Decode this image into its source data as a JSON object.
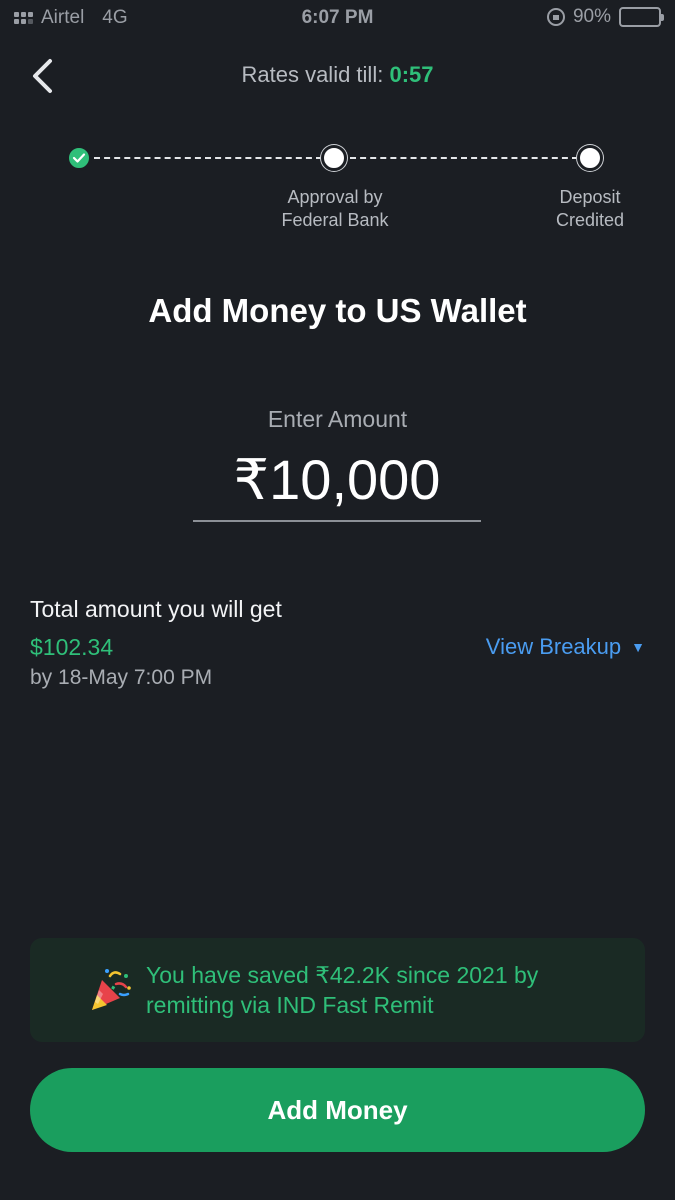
{
  "status_bar": {
    "carrier": "Airtel",
    "network": "4G",
    "time": "6:07 PM",
    "battery": "90%"
  },
  "header": {
    "rates_label": "Rates valid till:",
    "rates_timer": "0:57",
    "back_icon": "chevron-left-icon"
  },
  "stepper": {
    "steps": [
      {
        "label": "",
        "status": "done"
      },
      {
        "label_line1": "Approval by",
        "label_line2": "Federal Bank",
        "status": "pending"
      },
      {
        "label_line1": "Deposit",
        "label_line2": "Credited",
        "status": "pending"
      }
    ]
  },
  "main": {
    "title": "Add Money to US Wallet",
    "amount_label": "Enter Amount",
    "amount_value": "₹10,000",
    "total_label": "Total amount you will get",
    "total_value": "$102.34",
    "total_date": "by 18-May 7:00 PM",
    "view_breakup": "View Breakup"
  },
  "banner": {
    "icon": "party-popper-icon",
    "text": "You have saved ₹42.2K since 2021 by remitting via IND Fast Remit"
  },
  "cta": {
    "label": "Add Money"
  },
  "colors": {
    "background": "#1b1e23",
    "accent_green": "#2fbf79",
    "button_green": "#1a9e5e",
    "link_blue": "#4a9cf0"
  }
}
